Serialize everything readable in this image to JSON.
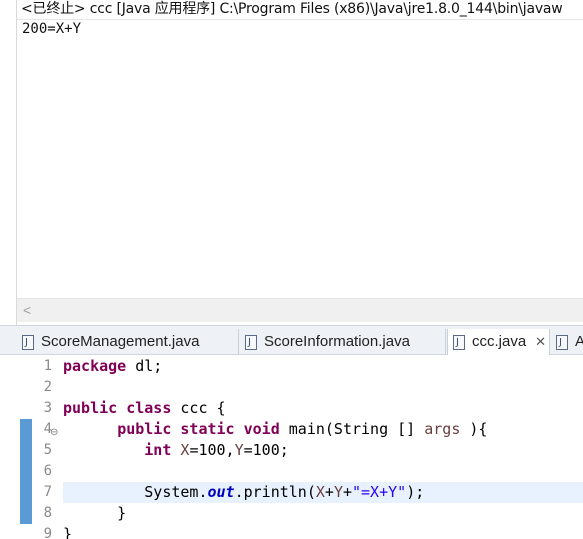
{
  "console": {
    "header": "<已终止> ccc [Java 应用程序] C:\\Program Files (x86)\\Java\\jre1.8.0_144\\bin\\javaw",
    "output": "200=X+Y",
    "scroll_left": "<"
  },
  "tabs": [
    {
      "label": "ScoreManagement.java",
      "icon": "java-file-icon"
    },
    {
      "label": "ScoreInformation.java",
      "icon": "java-file-icon"
    },
    {
      "label": "ccc.java",
      "icon": "java-file-icon",
      "close": "✕",
      "active": true
    },
    {
      "label": "A",
      "icon": "java-file-icon"
    }
  ],
  "editor": {
    "line_numbers": [
      "1",
      "2",
      "3",
      "4",
      "5",
      "6",
      "7",
      "8",
      "9"
    ],
    "lines": {
      "l1_kw": "package",
      "l1_rest": " dl;",
      "l3_kw1": "public",
      "l3_kw2": "class",
      "l3_rest": " ccc {",
      "l4_indent": "      ",
      "l4_kw1": "public",
      "l4_kw2": "static",
      "l4_kw3": "void",
      "l4_rest1": " main(String [] ",
      "l4_param": "args",
      "l4_rest2": " ){",
      "l5_indent": "         ",
      "l5_kw": "int",
      "l5_sp": " ",
      "l5_v1": "X",
      "l5_mid": "=100,",
      "l5_v2": "Y",
      "l5_end": "=100;",
      "l7_indent": "         ",
      "l7_a": "System.",
      "l7_field": "out",
      "l7_b": ".println(",
      "l7_v1": "X",
      "l7_plus1": "+",
      "l7_v2": "Y",
      "l7_plus2": "+",
      "l7_str": "\"=X+Y\"",
      "l7_end": ");",
      "l8": "      }",
      "l9": "}"
    }
  }
}
